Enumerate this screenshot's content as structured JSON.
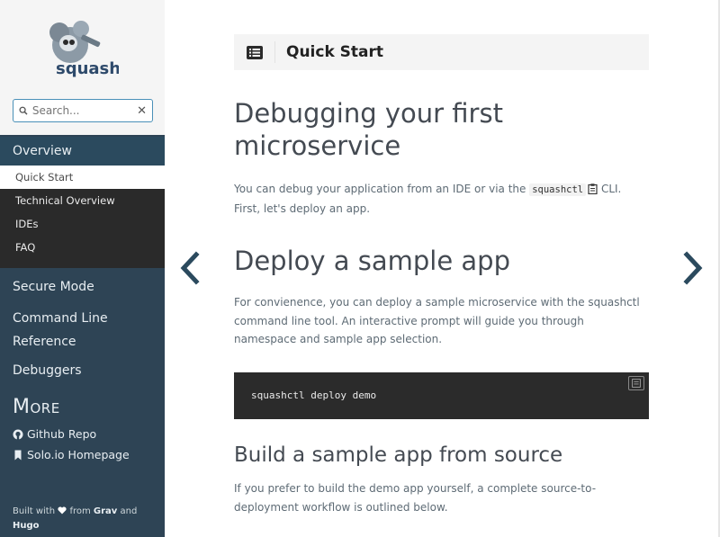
{
  "sidebar": {
    "logo_text": "squash",
    "search": {
      "placeholder": "Search..."
    },
    "nav": {
      "overview": "Overview",
      "sub_items": [
        "Quick Start",
        "Technical Overview",
        "IDEs",
        "FAQ"
      ],
      "items": [
        "Secure Mode",
        "Command Line Reference",
        "Debuggers"
      ]
    },
    "more": {
      "heading": "More",
      "shortcuts": [
        {
          "label": "Github Repo",
          "icon": "github-icon"
        },
        {
          "label": "Solo.io Homepage",
          "icon": "bookmark-icon"
        }
      ]
    },
    "footer": {
      "built_with": "Built with",
      "from": "from",
      "grav": "Grav",
      "and": "and",
      "hugo": "Hugo"
    }
  },
  "topbar": {
    "title": "Quick Start"
  },
  "content": {
    "h1": "Debugging your first microservice",
    "p1_before": "You can debug your application from an IDE or via the ",
    "p1_code": "squashctl",
    "p1_after": " CLI. First, let's deploy an app.",
    "h2": "Deploy a sample app",
    "p2": "For convienence, you can deploy a sample microservice with the squashctl command line tool. An interactive prompt will guide you through namespace and sample app selection.",
    "code": "squashctl deploy demo",
    "h3": "Build a sample app from source",
    "p3": "If you prefer to build the demo app yourself, a complete source-to-deployment workflow is outlined below."
  },
  "colors": {
    "sidebar_bg": "#2e4455",
    "submenu_bg": "#2a2a2a",
    "code_bg": "#2b2b2b",
    "arrow": "#2b4a5e"
  }
}
